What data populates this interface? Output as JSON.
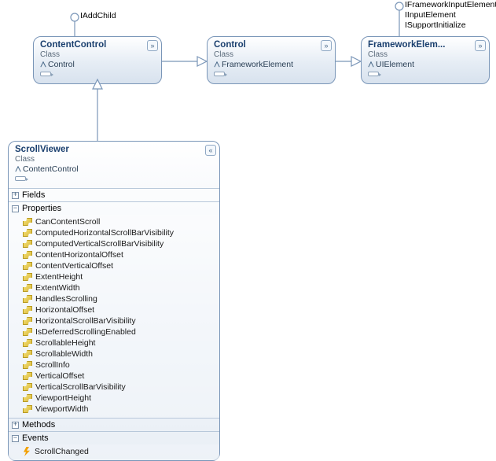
{
  "interfaces": {
    "iAddChild": "IAddChild",
    "fwInput": "IFrameworkInputElement",
    "input": "IInputElement",
    "supportInit": "ISupportInitialize"
  },
  "boxes": {
    "contentControl": {
      "name": "ContentControl",
      "kind": "Class",
      "base": "Control"
    },
    "control": {
      "name": "Control",
      "kind": "Class",
      "base": "FrameworkElement"
    },
    "frameworkElement": {
      "name": "FrameworkElem...",
      "kind": "Class",
      "base": "UIElement"
    },
    "scrollViewer": {
      "name": "ScrollViewer",
      "kind": "Class",
      "base": "ContentControl"
    }
  },
  "sections": {
    "fields": "Fields",
    "properties": "Properties",
    "methods": "Methods",
    "events": "Events"
  },
  "scrollViewerProperties": [
    "CanContentScroll",
    "ComputedHorizontalScrollBarVisibility",
    "ComputedVerticalScrollBarVisibility",
    "ContentHorizontalOffset",
    "ContentVerticalOffset",
    "ExtentHeight",
    "ExtentWidth",
    "HandlesScrolling",
    "HorizontalOffset",
    "HorizontalScrollBarVisibility",
    "IsDeferredScrollingEnabled",
    "ScrollableHeight",
    "ScrollableWidth",
    "ScrollInfo",
    "VerticalOffset",
    "VerticalScrollBarVisibility",
    "ViewportHeight",
    "ViewportWidth"
  ],
  "scrollViewerEvents": [
    "ScrollChanged"
  ],
  "glyphs": {
    "collapse": "«",
    "expand": "»",
    "plus": "+",
    "minus": "−"
  }
}
